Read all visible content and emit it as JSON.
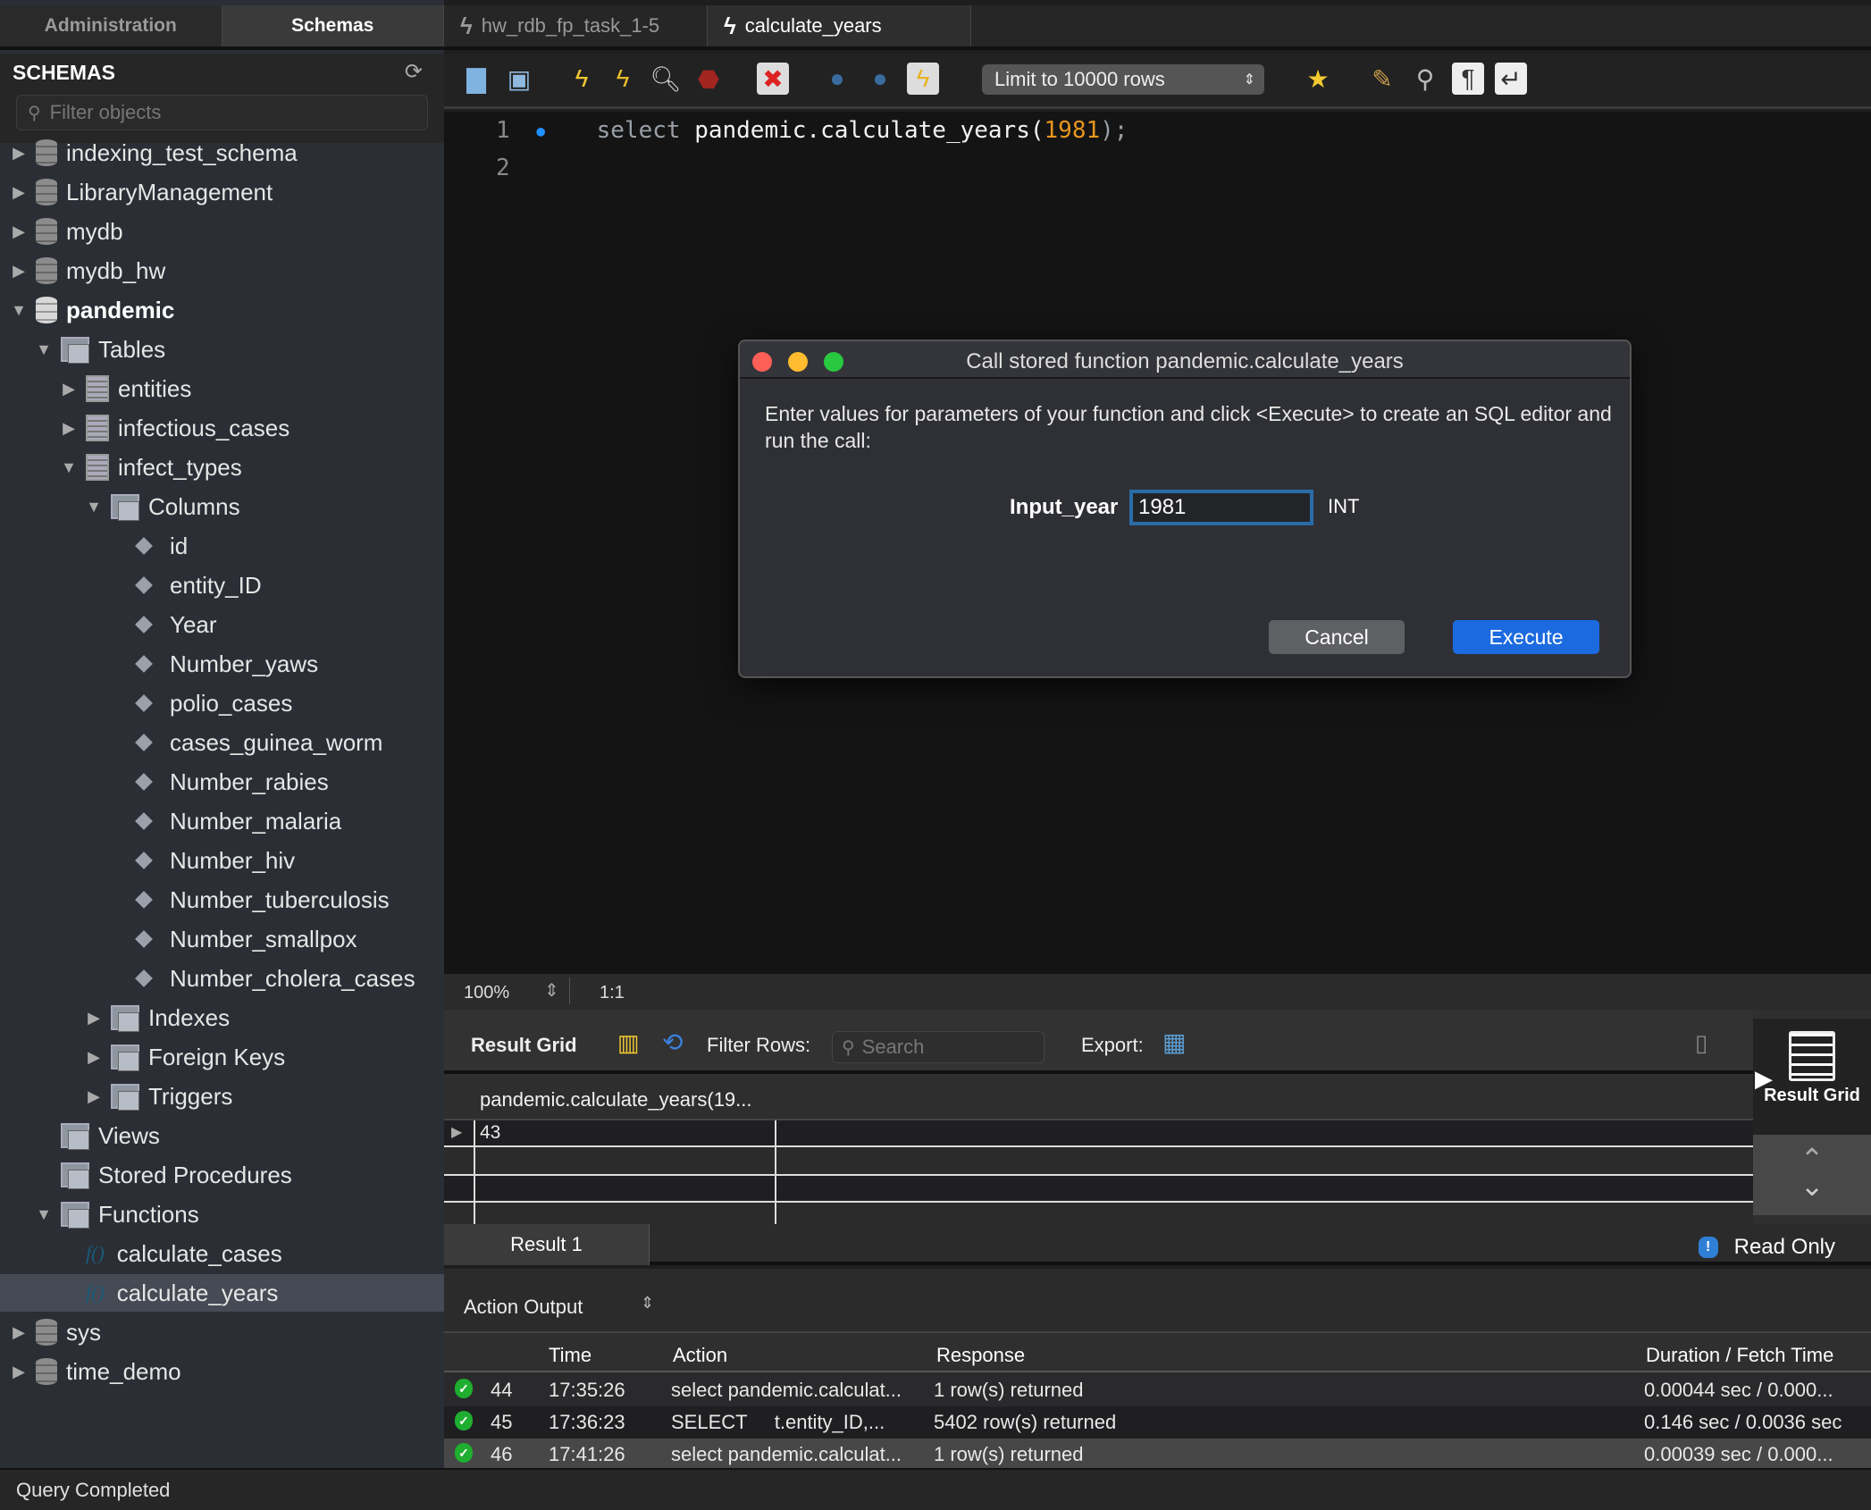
{
  "sidebar": {
    "tabs": [
      {
        "label": "Administration",
        "active": false
      },
      {
        "label": "Schemas",
        "active": true
      }
    ],
    "title": "SCHEMAS",
    "filter_placeholder": "Filter objects",
    "tree": [
      {
        "label": "indexing_test_schema",
        "type": "schema",
        "level": 0,
        "expanded": false
      },
      {
        "label": "LibraryManagement",
        "type": "schema",
        "level": 0,
        "expanded": false
      },
      {
        "label": "mydb",
        "type": "schema",
        "level": 0,
        "expanded": false
      },
      {
        "label": "mydb_hw",
        "type": "schema",
        "level": 0,
        "expanded": false
      },
      {
        "label": "pandemic",
        "type": "schema",
        "level": 0,
        "expanded": true,
        "bold": true
      },
      {
        "label": "Tables",
        "type": "group",
        "level": 1,
        "expanded": true
      },
      {
        "label": "entities",
        "type": "table",
        "level": 2,
        "expanded": false
      },
      {
        "label": "infectious_cases",
        "type": "table",
        "level": 2,
        "expanded": false
      },
      {
        "label": "infect_types",
        "type": "table",
        "level": 2,
        "expanded": true
      },
      {
        "label": "Columns",
        "type": "group",
        "level": 3,
        "expanded": true
      },
      {
        "label": "id",
        "type": "column",
        "level": 4
      },
      {
        "label": "entity_ID",
        "type": "column",
        "level": 4
      },
      {
        "label": "Year",
        "type": "column",
        "level": 4
      },
      {
        "label": "Number_yaws",
        "type": "column",
        "level": 4
      },
      {
        "label": "polio_cases",
        "type": "column",
        "level": 4
      },
      {
        "label": "cases_guinea_worm",
        "type": "column",
        "level": 4
      },
      {
        "label": "Number_rabies",
        "type": "column",
        "level": 4
      },
      {
        "label": "Number_malaria",
        "type": "column",
        "level": 4
      },
      {
        "label": "Number_hiv",
        "type": "column",
        "level": 4
      },
      {
        "label": "Number_tuberculosis",
        "type": "column",
        "level": 4
      },
      {
        "label": "Number_smallpox",
        "type": "column",
        "level": 4
      },
      {
        "label": "Number_cholera_cases",
        "type": "column",
        "level": 4
      },
      {
        "label": "Indexes",
        "type": "group",
        "level": 3,
        "expanded": false
      },
      {
        "label": "Foreign Keys",
        "type": "group",
        "level": 3,
        "expanded": false
      },
      {
        "label": "Triggers",
        "type": "group",
        "level": 3,
        "expanded": false
      },
      {
        "label": "Views",
        "type": "group",
        "level": 1,
        "leaf": true
      },
      {
        "label": "Stored Procedures",
        "type": "group",
        "level": 1,
        "leaf": true
      },
      {
        "label": "Functions",
        "type": "group",
        "level": 1,
        "expanded": true
      },
      {
        "label": "calculate_cases",
        "type": "function",
        "level": 2
      },
      {
        "label": "calculate_years",
        "type": "function",
        "level": 2,
        "selected": true
      },
      {
        "label": "sys",
        "type": "schema",
        "level": 0,
        "expanded": false
      },
      {
        "label": "time_demo",
        "type": "schema",
        "level": 0,
        "expanded": false
      }
    ]
  },
  "editor_tabs": [
    {
      "label": "hw_rdb_fp_task_1-5",
      "active": false
    },
    {
      "label": "calculate_years",
      "active": true
    }
  ],
  "toolbar": {
    "icons": [
      "open-folder-icon",
      "save-icon",
      "execute-icon",
      "execute-current-icon",
      "explain-icon",
      "stop-icon",
      "toggle-stop-on-error-icon",
      "commit-icon",
      "rollback-icon",
      "autocommit-icon"
    ],
    "limit_select": "Limit to 10000 rows",
    "right_icons": [
      "add-snippet-icon",
      "beautify-icon",
      "find-icon",
      "invisible-chars-icon",
      "word-wrap-icon"
    ]
  },
  "editor": {
    "lines": [
      {
        "number": "1",
        "keyword": "select",
        "body": "pandemic.calculate_years(",
        "arg": "1981",
        "tail": ");"
      },
      {
        "number": "2"
      }
    ]
  },
  "zoom_bar": {
    "zoom": "100%",
    "position": "1:1"
  },
  "result_grid": {
    "label": "Result Grid",
    "filter_label": "Filter Rows:",
    "search_placeholder": "Search",
    "export_label": "Export:",
    "column_header": "pandemic.calculate_years(19...",
    "rows": [
      "43"
    ],
    "side_panel_label": "Result Grid"
  },
  "result_tabs": {
    "tab": "Result 1",
    "status": "Read Only"
  },
  "action_output": {
    "title": "Action Output",
    "columns": [
      "",
      "Time",
      "Action",
      "Response",
      "Duration / Fetch Time"
    ],
    "rows": [
      {
        "num": "44",
        "time": "17:35:26",
        "action": "select pandemic.calculat...",
        "response": "1 row(s) returned",
        "duration": "0.00044 sec / 0.000..."
      },
      {
        "num": "45",
        "time": "17:36:23",
        "action": "SELECT     t.entity_ID,...",
        "response": "5402 row(s) returned",
        "duration": "0.146 sec / 0.0036 sec"
      },
      {
        "num": "46",
        "time": "17:41:26",
        "action": "select pandemic.calculat...",
        "response": "1 row(s) returned",
        "duration": "0.00039 sec / 0.000..."
      }
    ]
  },
  "status_bar": "Query Completed",
  "dialog": {
    "title": "Call stored function pandemic.calculate_years",
    "message": "Enter values for parameters of your function and click <Execute> to create an SQL editor and run the call:",
    "param_label": "Input_year",
    "param_value": "1981",
    "param_type": "INT",
    "cancel_label": "Cancel",
    "execute_label": "Execute",
    "colors": {
      "close": "#fe5f57",
      "minimize": "#febc2e",
      "zoom": "#28c840",
      "execute": "#1c6ae0"
    }
  }
}
